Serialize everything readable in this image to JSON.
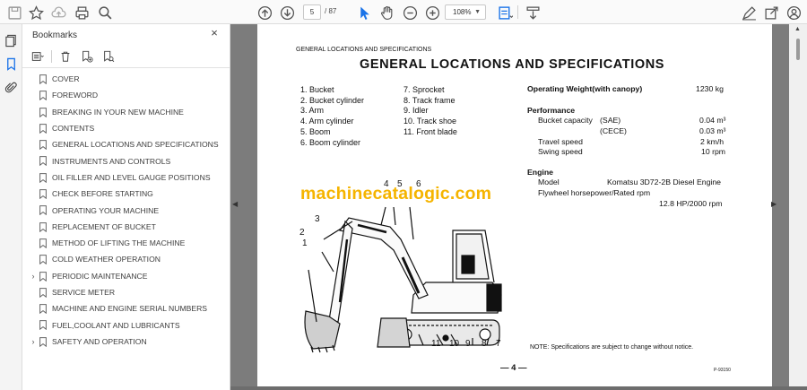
{
  "toolbar": {
    "current_page": "5",
    "page_separator": "/ 87",
    "zoom": "108%",
    "icons": [
      "save-icon",
      "bookmark-star-icon",
      "upload-icon",
      "print-icon",
      "search-icon",
      "previous-page-icon",
      "next-page-icon",
      "select-cursor-icon",
      "hand-tool-icon",
      "zoom-out-icon",
      "zoom-in-icon",
      "fit-page-icon",
      "scroll-mode-icon",
      "sign-icon",
      "share-icon",
      "account-icon"
    ]
  },
  "rail": {
    "icons": [
      "page-thumbnails-icon",
      "bookmarks-icon",
      "attachments-icon"
    ]
  },
  "bookmarks": {
    "title": "Bookmarks",
    "close": "×",
    "tools": [
      "options-menu-icon",
      "delete-bookmark-icon",
      "new-bookmark-icon",
      "find-bookmark-icon"
    ],
    "items": [
      {
        "label": "COVER",
        "expandable": false
      },
      {
        "label": "FOREWORD",
        "expandable": false
      },
      {
        "label": "BREAKING IN YOUR NEW MACHINE",
        "expandable": false
      },
      {
        "label": "CONTENTS",
        "expandable": false
      },
      {
        "label": "GENERAL LOCATIONS AND SPECIFICATIONS",
        "expandable": false
      },
      {
        "label": "INSTRUMENTS AND CONTROLS",
        "expandable": false
      },
      {
        "label": "OIL FILLER AND LEVEL GAUGE POSITIONS",
        "expandable": false
      },
      {
        "label": "CHECK BEFORE STARTING",
        "expandable": false
      },
      {
        "label": "OPERATING YOUR MACHINE",
        "expandable": false
      },
      {
        "label": "REPLACEMENT OF BUCKET",
        "expandable": false
      },
      {
        "label": "METHOD OF LIFTING THE MACHINE",
        "expandable": false
      },
      {
        "label": "COLD WEATHER OPERATION",
        "expandable": false
      },
      {
        "label": "PERIODIC MAINTENANCE",
        "expandable": true
      },
      {
        "label": "SERVICE METER",
        "expandable": false
      },
      {
        "label": "MACHINE AND ENGINE SERIAL NUMBERS",
        "expandable": false
      },
      {
        "label": "FUEL,COOLANT AND LUBRICANTS",
        "expandable": false
      },
      {
        "label": "SAFETY AND OPERATION",
        "expandable": true
      }
    ]
  },
  "document": {
    "running_head": "GENERAL LOCATIONS AND SPECIFICATIONS",
    "title": "GENERAL LOCATIONS AND SPECIFICATIONS",
    "parts_left": [
      "1. Bucket",
      "2. Bucket cylinder",
      "3. Arm",
      "4. Arm cylinder",
      "5. Boom",
      "6. Boom cylinder"
    ],
    "parts_right": [
      "7. Sprocket",
      "8. Track frame",
      "9. Idler",
      "10. Track shoe",
      "11. Front blade"
    ],
    "specs": {
      "operating_weight_label": "Operating Weight(with canopy)",
      "operating_weight_value": "1230 kg",
      "performance_heading": "Performance",
      "bucket_capacity_label": "Bucket capacity",
      "sae_label": "(SAE)",
      "sae_value": "0.04 m³",
      "cece_label": "(CECE)",
      "cece_value": "0.03 m³",
      "travel_speed_label": "Travel speed",
      "travel_speed_value": "2 km/h",
      "swing_speed_label": "Swing speed",
      "swing_speed_value": "10 rpm",
      "engine_heading": "Engine",
      "model_label": "Model",
      "model_value": "Komatsu 3D72-2B Diesel Engine",
      "flywheel_label": "Flywheel horsepower/Rated rpm",
      "flywheel_value": "12.8 HP/2000 rpm"
    },
    "watermark": "machinecatalogic.com",
    "callouts_top": [
      "4",
      "5",
      "6"
    ],
    "callout_3": "3",
    "callout_2": "2",
    "callout_1": "1",
    "callouts_bottom": [
      "11",
      "10",
      "9",
      "8",
      "7"
    ],
    "note": "NOTE:  Specifications are subject to change without notice.",
    "page_number": "— 4 —",
    "page_code": "P-93150"
  }
}
